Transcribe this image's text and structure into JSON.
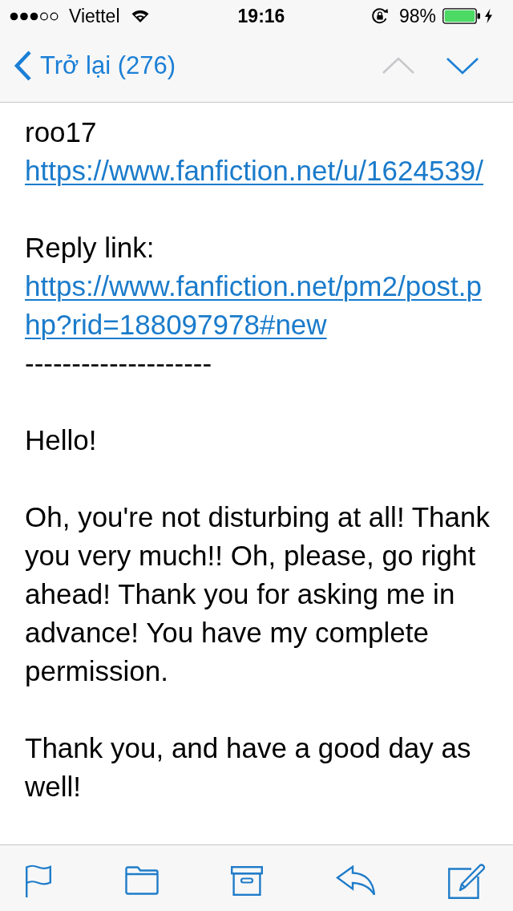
{
  "status_bar": {
    "carrier": "Viettel",
    "time": "19:16",
    "battery": "98%"
  },
  "nav": {
    "back": {
      "label": "Trở lại (276)"
    },
    "arrows": [
      {
        "kind": "up",
        "disabled": true
      },
      {
        "kind": "down",
        "disabled": false
      }
    ]
  },
  "message": {
    "paragraphs": [
      {
        "lines": [
          {
            "kind": "text",
            "text": "roo17"
          },
          {
            "kind": "link",
            "text": "https://www.fanfiction.net/u/1624539/"
          }
        ]
      },
      {
        "lines": [
          {
            "kind": "text",
            "text": "Reply link:"
          },
          {
            "kind": "link",
            "text": "https://www.fanfiction.net/pm2/post.php?rid=188097978#new"
          },
          {
            "kind": "text",
            "text": "--------------------"
          }
        ]
      },
      {
        "lines": [
          {
            "kind": "text",
            "text": "Hello!"
          }
        ]
      },
      {
        "lines": [
          {
            "kind": "text",
            "text": "Oh, you're not disturbing at all! Thank you very much!! Oh, please, go right ahead! Thank you for asking me in advance! You have my complete permission."
          }
        ]
      },
      {
        "lines": [
          {
            "kind": "text",
            "text": "Thank you, and have a good day as well!"
          }
        ]
      }
    ]
  }
}
